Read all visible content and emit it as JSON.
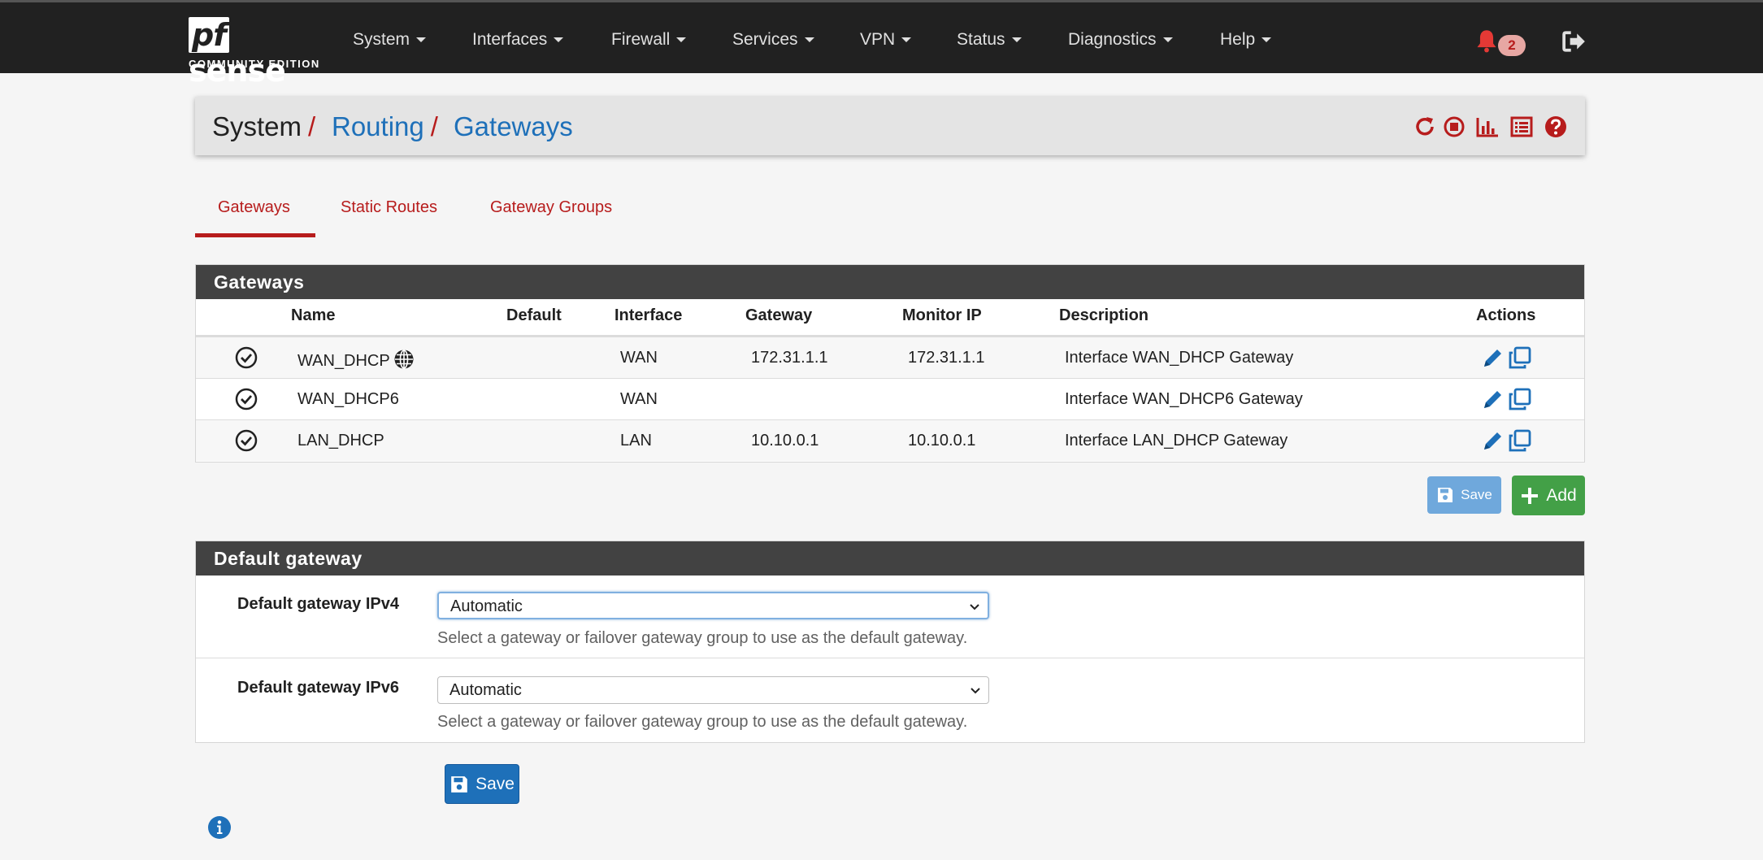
{
  "navbar": {
    "logo_main": "sense",
    "logo_pf": "pf",
    "logo_sub": "COMMUNITY EDITION",
    "menu": [
      "System",
      "Interfaces",
      "Firewall",
      "Services",
      "VPN",
      "Status",
      "Diagnostics",
      "Help"
    ],
    "notification_count": "2",
    "icons": [
      "bell-icon",
      "logout-icon"
    ]
  },
  "breadcrumb": {
    "items": [
      "System",
      "Routing",
      "Gateways"
    ],
    "separator": "/",
    "actions": [
      "reload-icon",
      "stop-icon",
      "chart-icon",
      "log-icon",
      "help-icon"
    ]
  },
  "tabs": [
    "Gateways",
    "Static Routes",
    "Gateway Groups"
  ],
  "active_tab": "Gateways",
  "gateways_panel": {
    "title": "Gateways",
    "columns": [
      "Name",
      "Default",
      "Interface",
      "Gateway",
      "Monitor IP",
      "Description",
      "Actions"
    ],
    "rows": [
      {
        "name": "WAN_DHCP",
        "interface": "WAN",
        "gateway": "172.31.1.1",
        "monitor": "172.31.1.1",
        "description": "Interface WAN_DHCP Gateway",
        "default_globe": true
      },
      {
        "name": "WAN_DHCP6",
        "interface": "WAN",
        "gateway": "",
        "monitor": "",
        "description": "Interface WAN_DHCP6 Gateway",
        "default_globe": false
      },
      {
        "name": "LAN_DHCP",
        "interface": "LAN",
        "gateway": "10.10.0.1",
        "monitor": "10.10.0.1",
        "description": "Interface LAN_DHCP Gateway",
        "default_globe": false
      }
    ],
    "save_label": "Save",
    "add_label": "Add"
  },
  "default_gateway_panel": {
    "title": "Default gateway",
    "ipv4_label": "Default gateway IPv4",
    "ipv4_value": "Automatic",
    "ipv6_label": "Default gateway IPv6",
    "ipv6_value": "Automatic",
    "help": "Select a gateway or failover gateway group to use as the default gateway."
  },
  "save_label": "Save",
  "colors": {
    "navbar": "#212121",
    "accent_red": "#b71c1c",
    "link_blue": "#1e70b9",
    "add_green": "#43a047"
  }
}
